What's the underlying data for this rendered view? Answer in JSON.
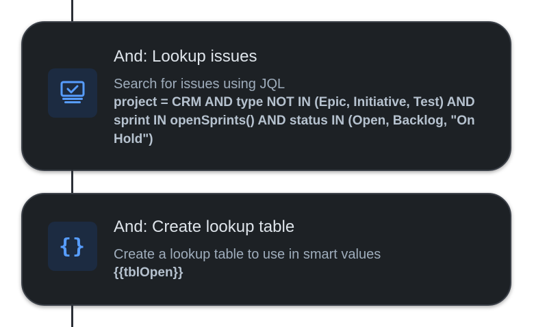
{
  "steps": [
    {
      "title": "And: Lookup issues",
      "description": "Search for issues using JQL",
      "detail": "project = CRM AND type NOT IN (Epic, Initiative, Test) AND sprint IN openSprints() AND status IN (Open, Backlog, \"On Hold\")",
      "icon": "issue-search-icon"
    },
    {
      "title": "And: Create lookup table",
      "description": "Create a lookup table to use in smart values",
      "detail": "{{tblOpen}}",
      "icon": "curly-braces-icon",
      "icon_glyph": "{}"
    }
  ],
  "colors": {
    "card_background": "#1d2125",
    "card_border": "#3b4048",
    "icon_tile": "#1c2b41",
    "icon_accent": "#579dff",
    "connector": "#2b2f36"
  }
}
